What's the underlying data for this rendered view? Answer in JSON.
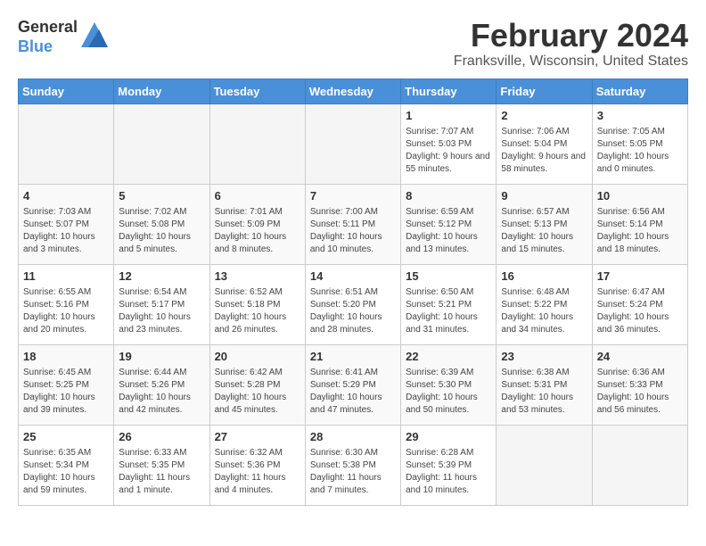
{
  "logo": {
    "line1": "General",
    "line2": "Blue"
  },
  "title": "February 2024",
  "location": "Franksville, Wisconsin, United States",
  "days_of_week": [
    "Sunday",
    "Monday",
    "Tuesday",
    "Wednesday",
    "Thursday",
    "Friday",
    "Saturday"
  ],
  "weeks": [
    [
      {
        "day": "",
        "info": ""
      },
      {
        "day": "",
        "info": ""
      },
      {
        "day": "",
        "info": ""
      },
      {
        "day": "",
        "info": ""
      },
      {
        "day": "1",
        "info": "Sunrise: 7:07 AM\nSunset: 5:03 PM\nDaylight: 9 hours\nand 55 minutes."
      },
      {
        "day": "2",
        "info": "Sunrise: 7:06 AM\nSunset: 5:04 PM\nDaylight: 9 hours\nand 58 minutes."
      },
      {
        "day": "3",
        "info": "Sunrise: 7:05 AM\nSunset: 5:05 PM\nDaylight: 10 hours\nand 0 minutes."
      }
    ],
    [
      {
        "day": "4",
        "info": "Sunrise: 7:03 AM\nSunset: 5:07 PM\nDaylight: 10 hours\nand 3 minutes."
      },
      {
        "day": "5",
        "info": "Sunrise: 7:02 AM\nSunset: 5:08 PM\nDaylight: 10 hours\nand 5 minutes."
      },
      {
        "day": "6",
        "info": "Sunrise: 7:01 AM\nSunset: 5:09 PM\nDaylight: 10 hours\nand 8 minutes."
      },
      {
        "day": "7",
        "info": "Sunrise: 7:00 AM\nSunset: 5:11 PM\nDaylight: 10 hours\nand 10 minutes."
      },
      {
        "day": "8",
        "info": "Sunrise: 6:59 AM\nSunset: 5:12 PM\nDaylight: 10 hours\nand 13 minutes."
      },
      {
        "day": "9",
        "info": "Sunrise: 6:57 AM\nSunset: 5:13 PM\nDaylight: 10 hours\nand 15 minutes."
      },
      {
        "day": "10",
        "info": "Sunrise: 6:56 AM\nSunset: 5:14 PM\nDaylight: 10 hours\nand 18 minutes."
      }
    ],
    [
      {
        "day": "11",
        "info": "Sunrise: 6:55 AM\nSunset: 5:16 PM\nDaylight: 10 hours\nand 20 minutes."
      },
      {
        "day": "12",
        "info": "Sunrise: 6:54 AM\nSunset: 5:17 PM\nDaylight: 10 hours\nand 23 minutes."
      },
      {
        "day": "13",
        "info": "Sunrise: 6:52 AM\nSunset: 5:18 PM\nDaylight: 10 hours\nand 26 minutes."
      },
      {
        "day": "14",
        "info": "Sunrise: 6:51 AM\nSunset: 5:20 PM\nDaylight: 10 hours\nand 28 minutes."
      },
      {
        "day": "15",
        "info": "Sunrise: 6:50 AM\nSunset: 5:21 PM\nDaylight: 10 hours\nand 31 minutes."
      },
      {
        "day": "16",
        "info": "Sunrise: 6:48 AM\nSunset: 5:22 PM\nDaylight: 10 hours\nand 34 minutes."
      },
      {
        "day": "17",
        "info": "Sunrise: 6:47 AM\nSunset: 5:24 PM\nDaylight: 10 hours\nand 36 minutes."
      }
    ],
    [
      {
        "day": "18",
        "info": "Sunrise: 6:45 AM\nSunset: 5:25 PM\nDaylight: 10 hours\nand 39 minutes."
      },
      {
        "day": "19",
        "info": "Sunrise: 6:44 AM\nSunset: 5:26 PM\nDaylight: 10 hours\nand 42 minutes."
      },
      {
        "day": "20",
        "info": "Sunrise: 6:42 AM\nSunset: 5:28 PM\nDaylight: 10 hours\nand 45 minutes."
      },
      {
        "day": "21",
        "info": "Sunrise: 6:41 AM\nSunset: 5:29 PM\nDaylight: 10 hours\nand 47 minutes."
      },
      {
        "day": "22",
        "info": "Sunrise: 6:39 AM\nSunset: 5:30 PM\nDaylight: 10 hours\nand 50 minutes."
      },
      {
        "day": "23",
        "info": "Sunrise: 6:38 AM\nSunset: 5:31 PM\nDaylight: 10 hours\nand 53 minutes."
      },
      {
        "day": "24",
        "info": "Sunrise: 6:36 AM\nSunset: 5:33 PM\nDaylight: 10 hours\nand 56 minutes."
      }
    ],
    [
      {
        "day": "25",
        "info": "Sunrise: 6:35 AM\nSunset: 5:34 PM\nDaylight: 10 hours\nand 59 minutes."
      },
      {
        "day": "26",
        "info": "Sunrise: 6:33 AM\nSunset: 5:35 PM\nDaylight: 11 hours\nand 1 minute."
      },
      {
        "day": "27",
        "info": "Sunrise: 6:32 AM\nSunset: 5:36 PM\nDaylight: 11 hours\nand 4 minutes."
      },
      {
        "day": "28",
        "info": "Sunrise: 6:30 AM\nSunset: 5:38 PM\nDaylight: 11 hours\nand 7 minutes."
      },
      {
        "day": "29",
        "info": "Sunrise: 6:28 AM\nSunset: 5:39 PM\nDaylight: 11 hours\nand 10 minutes."
      },
      {
        "day": "",
        "info": ""
      },
      {
        "day": "",
        "info": ""
      }
    ]
  ]
}
